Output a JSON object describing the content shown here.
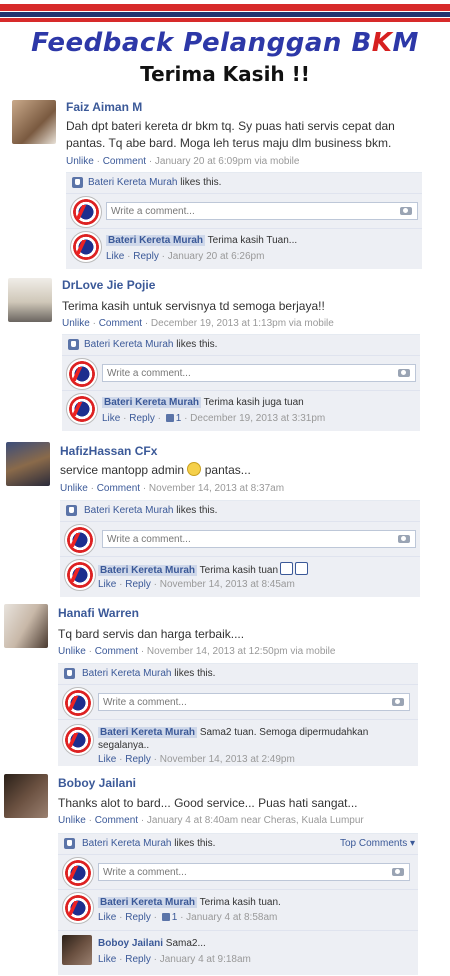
{
  "header": {
    "title_main": "Feedback Pelanggan B",
    "title_k": "K",
    "title_m": "M",
    "subtitle": "Terima Kasih !!",
    "colors": {
      "red": "#d72a2a",
      "blue": "#23336f"
    }
  },
  "ui": {
    "unlike": "Unlike",
    "comment": "Comment",
    "like": "Like",
    "reply": "Reply",
    "write_placeholder": "Write a comment...",
    "likes_suffix": "likes this.",
    "top_comments": "Top Comments",
    "page_name": "Bateri Kereta Murah"
  },
  "posts": [
    {
      "author": "Faiz Aiman M",
      "text": "Dah dpt bateri kereta dr bkm tq. Sy puas hati servis cepat dan pantas. Tq abe bard. Moga leh terus maju dlm business bkm.",
      "meta": "· January 20 at 6:09pm via mobile",
      "reply_text": "Terima kasih Tuan...",
      "reply_meta": "· January 20 at 6:26pm"
    },
    {
      "author": "DrLove Jie Pojie",
      "text": "Terima kasih untuk servisnya td semoga berjaya!!",
      "meta": "· December 19, 2013 at 1:13pm via mobile",
      "reply_text": "Terima kasih juga tuan",
      "reply_meta": "· December 19, 2013 at 3:31pm",
      "reply_likes": "1"
    },
    {
      "author": "HafizHassan CFx",
      "text_a": "service mantopp admin",
      "text_b": "pantas...",
      "meta": "· November 14, 2013 at 8:37am",
      "reply_text": "Terima kasih tuan",
      "reply_meta": "· November 14, 2013 at 8:45am"
    },
    {
      "author": "Hanafi Warren",
      "text": "Tq bard servis dan harga terbaik....",
      "meta": "· November 14, 2013 at 12:50pm via mobile",
      "reply_text_1": "Sama2 tuan. Semoga dipermudahkan",
      "reply_text_2": "segalanya..",
      "reply_meta": "· November 14, 2013 at 2:49pm"
    },
    {
      "author": "Boboy Jailani",
      "text": "Thanks alot to bard... Good service... Puas hati sangat...",
      "meta": "· January 4 at 8:40am near Cheras, Kuala Lumpur",
      "reply_text": "Terima kasih tuan.",
      "reply_meta": "· January 4 at 8:58am",
      "reply_likes": "1",
      "sub_author": "Boboy Jailani",
      "sub_text": "Sama2...",
      "sub_meta": "· January 4 at 9:18am"
    }
  ]
}
